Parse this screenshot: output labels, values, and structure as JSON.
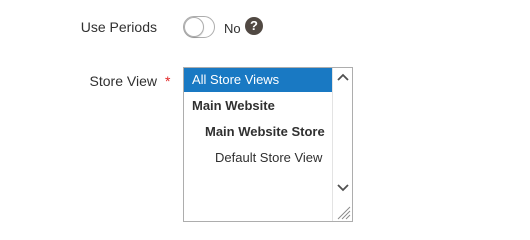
{
  "use_periods": {
    "label": "Use Periods",
    "state_text": "No",
    "help_glyph": "?"
  },
  "store_view": {
    "label": "Store View",
    "required_mark": "*",
    "options": [
      {
        "label": "All Store Views",
        "selected": true
      },
      {
        "label": "Main Website",
        "selected": false
      },
      {
        "label": "Main Website Store",
        "selected": false
      },
      {
        "label": "Default Store View",
        "selected": false
      }
    ]
  },
  "colors": {
    "selected_bg": "#1979c3",
    "required": "#e22626",
    "help_icon_bg": "#514943"
  }
}
